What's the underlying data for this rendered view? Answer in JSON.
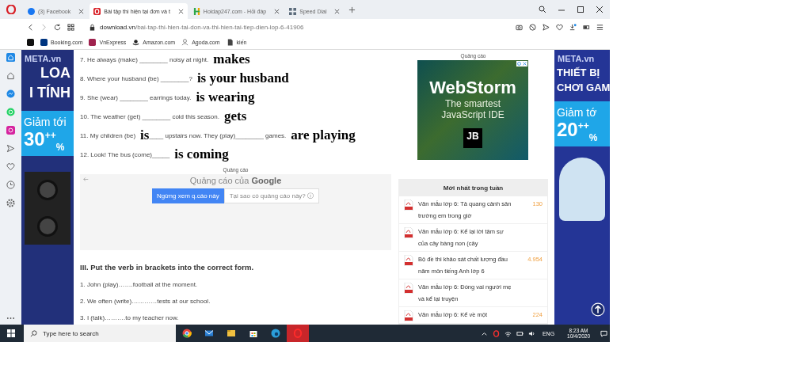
{
  "browser": {
    "tabs": [
      {
        "title": "(3) Facebook",
        "kind": "facebook",
        "selected": false
      },
      {
        "title": "Bài tập thì hiện tại đơn và t",
        "kind": "opera",
        "selected": true
      },
      {
        "title": "Hoidap247.com - Hỏi đáp",
        "kind": "hoidap",
        "selected": false
      },
      {
        "title": "Speed Dial",
        "kind": "speeddial",
        "selected": false
      }
    ],
    "address": {
      "domain": "download.vn",
      "path": "/bai-tap-thi-hien-tai-don-va-thi-hien-tai-tiep-dien-lop-6-41906"
    },
    "bookmarks": [
      {
        "kind": "tiktok"
      },
      {
        "label": "Booking.com",
        "kind": "booking"
      },
      {
        "label": "VnExpress",
        "kind": "vnexpress"
      },
      {
        "label": "Amazon.com",
        "kind": "amazon"
      },
      {
        "label": "Agoda.com",
        "kind": "agoda"
      },
      {
        "label": "kiến",
        "kind": "file"
      }
    ]
  },
  "left_ad": {
    "brand": "META.vn",
    "line1": "LOA",
    "line2": "I TÍNH",
    "promo": "Giảm tới",
    "discount": "30",
    "mark": "++",
    "percent": "%"
  },
  "exercises": [
    {
      "parts": [
        {
          "kind": "text",
          "text": "7. He always (make) ________ noisy at night."
        },
        {
          "kind": "answer",
          "text": "makes"
        }
      ]
    },
    {
      "parts": [
        {
          "kind": "text",
          "text": "8. Where your husband (be) ________?"
        },
        {
          "kind": "answer",
          "text": "is your husband"
        }
      ]
    },
    {
      "parts": [
        {
          "kind": "text",
          "text": "9. She (wear) ________ earrings today."
        },
        {
          "kind": "answer",
          "text": "is wearing"
        }
      ]
    },
    {
      "parts": [
        {
          "kind": "text",
          "text": "10. The weather (get) ________ cold this season."
        },
        {
          "kind": "answer",
          "text": "gets"
        }
      ]
    },
    {
      "parts": [
        {
          "kind": "text",
          "text": "11. My children (be)"
        },
        {
          "kind": "answer",
          "text": "is"
        },
        {
          "kind": "text",
          "text": "____ upstairs now. They (play)________ games."
        },
        {
          "kind": "answer",
          "text": "are playing"
        }
      ]
    },
    {
      "parts": [
        {
          "kind": "text",
          "text": "12. Look! The bus (come)_____"
        },
        {
          "kind": "answer",
          "text": "is coming"
        }
      ]
    }
  ],
  "ad_label": "Quảng cáo",
  "google_ad": {
    "heading": "Quảng cáo của",
    "brand": "Google",
    "stop_button": "Ngừng xem q.cáo này",
    "why_button": "Tại sao có quảng cáo này? ⓘ"
  },
  "section": {
    "heading": "III. Put the verb in brackets into the correct form.",
    "items": [
      "1. John (play)…….football at the moment.",
      "2. We often (write)…………tests at our school.",
      "3. I (talk)……….to my teacher now."
    ]
  },
  "right_column": {
    "ad_label": "Quảng cáo",
    "webstorm_ad": {
      "title": "WebStorm",
      "line1": "The smartest",
      "line2": "JavaScript IDE",
      "logo": "JB"
    },
    "latest": {
      "title": "Mới nhất trong tuần",
      "items": [
        {
          "title": "Văn mẫu lớp 6: Tả quang cảnh sân trường em trong giờ",
          "count": "130"
        },
        {
          "title": "Văn mẫu lớp 6: Kể lại lời tâm sự của cây bàng non (cây"
        },
        {
          "title": "Bộ đề thi khảo sát chất lượng đầu năm môn tiếng Anh lớp 6",
          "count": "4.954"
        },
        {
          "title": "Văn mẫu lớp 6: Đóng vai người mẹ và kể lại truyện"
        },
        {
          "title": "Văn mẫu lớp 6: Kể về một",
          "count": "224"
        }
      ]
    }
  },
  "right_ad": {
    "brand": "META.vn",
    "line1": "THIẾT BỊ",
    "line2": "CHƠI GAM",
    "promo": "Giảm tớ",
    "discount": "20",
    "mark": "++",
    "percent": "%"
  },
  "taskbar": {
    "search_placeholder": "Type here to search",
    "apps": [
      {
        "kind": "chrome",
        "selected": false
      },
      {
        "kind": "mail",
        "selected": false
      },
      {
        "kind": "files",
        "selected": false
      },
      {
        "kind": "store",
        "selected": false
      },
      {
        "kind": "edge",
        "selected": false
      },
      {
        "kind": "opera",
        "selected": true
      }
    ],
    "language": "ENG",
    "time": "8:23 AM",
    "date": "10/4/2020"
  }
}
